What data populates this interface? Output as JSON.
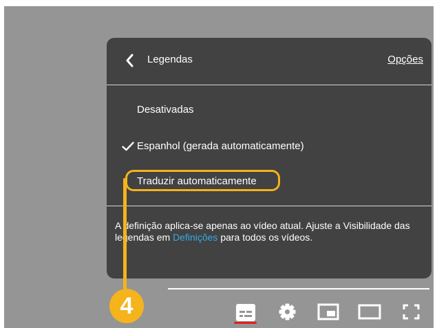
{
  "menu": {
    "back_icon": "chevron-left-icon",
    "title": "Legendas",
    "options_label": "Opções"
  },
  "items": [
    {
      "label": "Desativadas",
      "selected": false
    },
    {
      "label": "Espanhol (gerada automaticamente)",
      "selected": true,
      "check_icon": "check-icon"
    },
    {
      "label": "Traduzir automaticamente",
      "selected": false
    }
  ],
  "info": {
    "text_before": "A definição aplica-se apenas ao vídeo atual. Ajuste a Visibilidade das legendas em ",
    "link_text": "Definições",
    "text_after": " para todos os vídeos."
  },
  "annotation": {
    "step_number": "4",
    "color": "#f5b31c"
  },
  "controls": [
    {
      "name": "subtitles",
      "icon": "subtitles-icon",
      "active": true
    },
    {
      "name": "settings",
      "icon": "gear-icon"
    },
    {
      "name": "mini-player",
      "icon": "mini-player-icon"
    },
    {
      "name": "theater-mode",
      "icon": "theater-icon"
    },
    {
      "name": "fullscreen",
      "icon": "fullscreen-icon"
    }
  ],
  "colors": {
    "menu_background": "#424242",
    "video_background": "#959595",
    "link": "#38a8e8",
    "active_underline": "#e02020"
  }
}
